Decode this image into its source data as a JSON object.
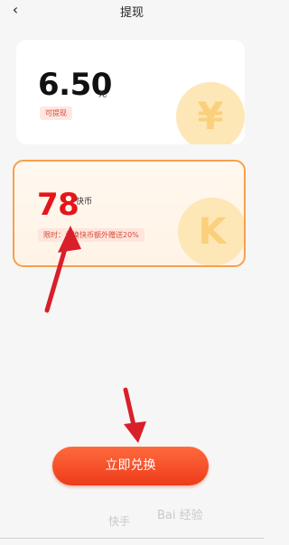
{
  "header": {
    "title": "提现"
  },
  "card_cash": {
    "amount": "6.50",
    "unit": "元",
    "badge": "可提现",
    "icon": "yuan-coin-icon"
  },
  "card_coin": {
    "amount": "78",
    "unit": "快币",
    "badge": "限时：兑换快币额外赠送20%",
    "icon": "k-coin-icon"
  },
  "primary_button": {
    "label": "立即兑换"
  },
  "watermark": {
    "left_text": "快手",
    "right_text": "Bai 经验"
  },
  "colors": {
    "accent_red": "#e4161b",
    "button_orange": "#ff6a3d",
    "card_border": "#f7a04c",
    "annotation_arrow": "#d81f2a"
  }
}
